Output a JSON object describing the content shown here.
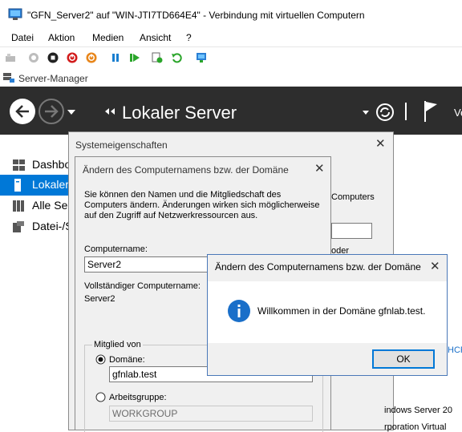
{
  "vm_window": {
    "title": "\"GFN_Server2\" auf \"WIN-JTI7TD664E4\" - Verbindung mit virtuellen Computern",
    "menu": [
      "Datei",
      "Aktion",
      "Medien",
      "Ansicht",
      "?"
    ]
  },
  "server_manager": {
    "window_title": "Server-Manager",
    "page_title": "Lokaler Server",
    "header_partial": "Ve",
    "nav_items": [
      "Dashbo",
      "Lokaler",
      "Alle Ser",
      "Datei-/S"
    ]
  },
  "system_properties": {
    "title": "Systemeigenschaften",
    "bg_fragments": {
      "computers": "Computers",
      "oder": "oder",
      "hcp": "HCP",
      "windows_server": "indows Server 20",
      "virtual": "rporation Virtual"
    }
  },
  "rename_dialog": {
    "title": "Ändern des Computernamens bzw. der Domäne",
    "intro": "Sie können den Namen und die Mitgliedschaft des Computers ändern. Änderungen wirken sich möglicherweise auf den Zugriff auf Netzwerkressourcen aus.",
    "computername_label": "Computername:",
    "computername_value": "Server2",
    "full_name_label": "Vollständiger Computername:",
    "full_name_value": "Server2",
    "member_of_label": "Mitglied von",
    "domain_label": "Domäne:",
    "domain_value": "gfnlab.test",
    "workgroup_label": "Arbeitsgruppe:",
    "workgroup_value": "WORKGROUP"
  },
  "message_box": {
    "title": "Ändern des Computernamens bzw. der Domäne",
    "message": "Willkommen in der Domäne gfnlab.test.",
    "ok_label": "OK",
    "icon": "info-icon"
  },
  "colors": {
    "header_bg": "#2d2d2d",
    "nav_selected": "#0078d7",
    "info_blue": "#1a6fc9"
  }
}
